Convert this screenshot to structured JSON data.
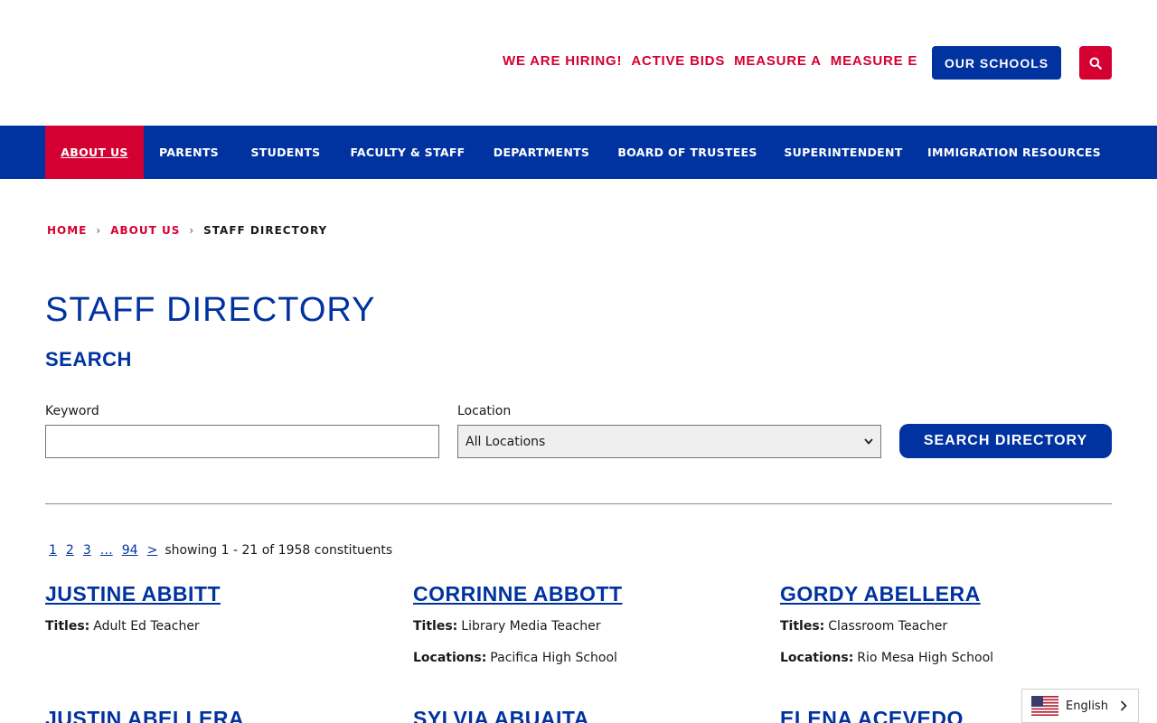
{
  "header": {
    "util_links": [
      "WE ARE HIRING!",
      "ACTIVE BIDS",
      "MEASURE A",
      "MEASURE E"
    ],
    "schools_button": "OUR SCHOOLS",
    "search_icon": "search-icon"
  },
  "nav": {
    "items": [
      "ABOUT US",
      "PARENTS",
      "STUDENTS",
      "FACULTY & STAFF",
      "DEPARTMENTS",
      "BOARD OF TRUSTEES",
      "SUPERINTENDENT",
      "IMMIGRATION RESOURCES"
    ],
    "active": "ABOUT US"
  },
  "breadcrumb": {
    "home": "HOME",
    "parent": "ABOUT US",
    "current": "STAFF DIRECTORY"
  },
  "page": {
    "title": "STAFF DIRECTORY",
    "search_heading": "SEARCH"
  },
  "form": {
    "keyword_label": "Keyword",
    "keyword_value": "",
    "location_label": "Location",
    "location_selected": "All Locations",
    "submit_label": "SEARCH DIRECTORY"
  },
  "pagination": {
    "pages": [
      "1",
      "2",
      "3",
      "…",
      "94",
      ">"
    ],
    "summary": "showing 1 - 21 of 1958 constituents"
  },
  "labels": {
    "titles": "Titles:",
    "locations": "Locations:"
  },
  "staff": [
    {
      "name": "JUSTINE ABBITT",
      "title": "Adult Ed Teacher",
      "location": ""
    },
    {
      "name": "CORRINNE ABBOTT",
      "title": "Library Media Teacher",
      "location": "Pacifica High School"
    },
    {
      "name": "GORDY ABELLERA",
      "title": "Classroom Teacher",
      "location": "Rio Mesa High School"
    },
    {
      "name": "JUSTIN ABELLERA",
      "title": "",
      "location": ""
    },
    {
      "name": "SYLVIA ABUAITA",
      "title": "",
      "location": ""
    },
    {
      "name": "ELENA ACEVEDO",
      "title": "",
      "location": ""
    }
  ],
  "language": {
    "label": "English"
  },
  "colors": {
    "brand_blue": "#0033a0",
    "brand_red": "#d50032"
  }
}
